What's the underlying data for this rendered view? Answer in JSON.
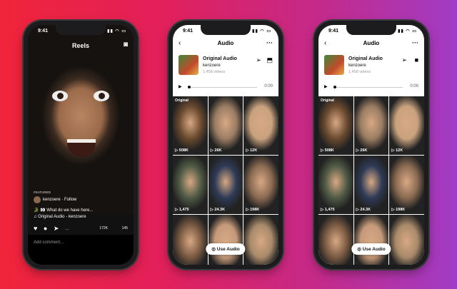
{
  "status": {
    "time": "9:41",
    "icons": "▮▮ ◠ ▭"
  },
  "reels": {
    "title": "Reels",
    "featured_label": "FEATURED",
    "username": "kenzoere · Follow",
    "caption": "🐊 👀 What do we have here...",
    "audio_line": "♫ Original Audio - kenzoere",
    "likes": "172K",
    "comments": "145",
    "more": "···",
    "comment_placeholder": "Add comment..."
  },
  "audio": {
    "back_icon": "‹",
    "title": "Audio",
    "more": "···",
    "name": "Original Audio",
    "user": "kenzoere",
    "videos": "1,458 videos",
    "duration": "0:00",
    "use_audio_label": "Use Audio",
    "grid": [
      {
        "tag": "Original",
        "count": "508K",
        "color": "#6b4a2f"
      },
      {
        "tag": "",
        "count": "26K",
        "color": "#9b7d63"
      },
      {
        "tag": "",
        "count": "12K",
        "color": "#c9a27e"
      },
      {
        "tag": "",
        "count": "1,475",
        "color": "#4f5a44"
      },
      {
        "tag": "",
        "count": "24.3K",
        "color": "#2e3a56"
      },
      {
        "tag": "",
        "count": "198K",
        "color": "#8a6a52"
      },
      {
        "tag": "",
        "count": "",
        "color": "#7a5a42"
      },
      {
        "tag": "",
        "count": "",
        "color": "#c59a7a"
      },
      {
        "tag": "",
        "count": "",
        "color": "#a88a6a"
      }
    ]
  },
  "colors": {
    "bg_start": "#f0243a",
    "bg_end": "#a03cc6"
  }
}
